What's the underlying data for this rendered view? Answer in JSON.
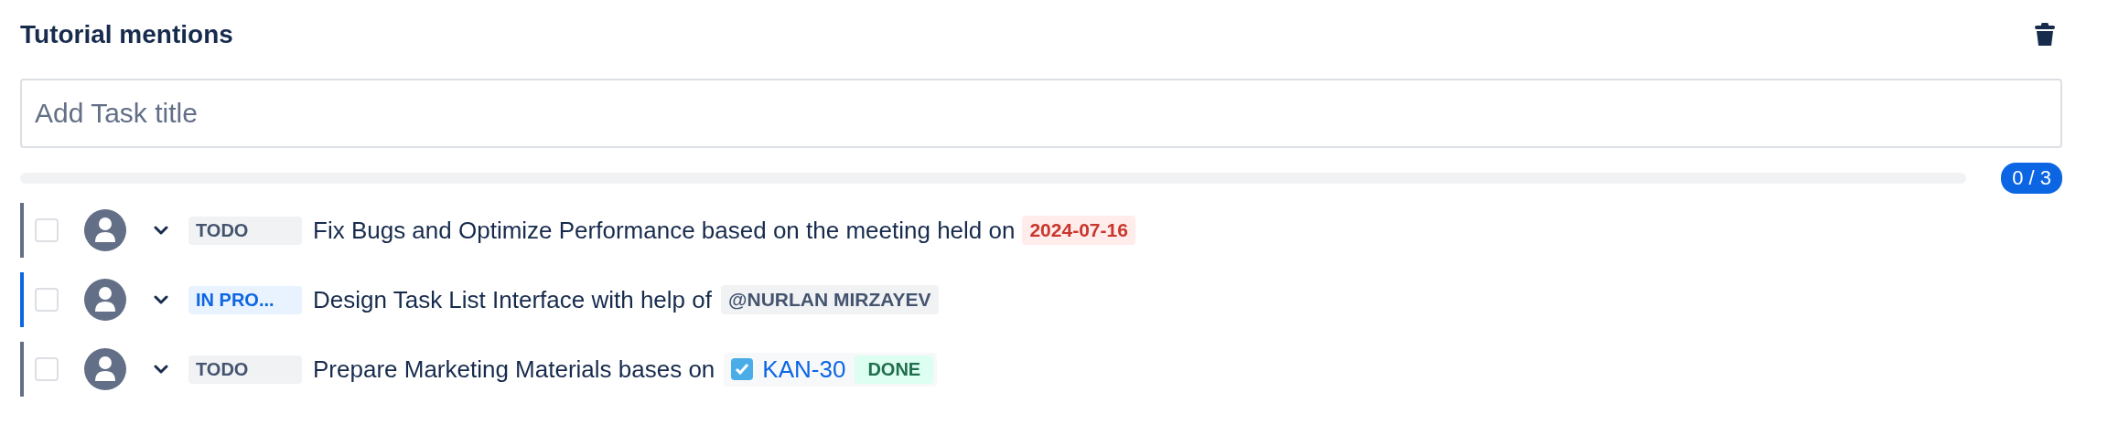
{
  "header": {
    "title": "Tutorial mentions"
  },
  "new_task": {
    "placeholder": "Add Task title"
  },
  "progress": {
    "level": 0,
    "count": "0 / 3"
  },
  "tasks": [
    {
      "checked": false,
      "expanded": false,
      "status": {
        "kind": "todo",
        "label": "TODO"
      },
      "parts": [
        {
          "kind": "text",
          "text": "Fix Bugs and Optimize Performance based on the meeting held on"
        },
        {
          "kind": "date",
          "text": "2024-07-16"
        }
      ]
    },
    {
      "checked": false,
      "expanded": false,
      "status": {
        "kind": "inprogress",
        "label": "IN PRO..."
      },
      "parts": [
        {
          "kind": "text",
          "text": "Design Task List Interface with help of"
        },
        {
          "kind": "mention",
          "text": "@NURLAN MIRZAYEV"
        }
      ]
    },
    {
      "checked": false,
      "expanded": false,
      "status": {
        "kind": "todo",
        "label": "TODO"
      },
      "parts": [
        {
          "kind": "text",
          "text": "Prepare Marketing Materials bases on"
        },
        {
          "kind": "issue",
          "key": "KAN-30",
          "status": "DONE"
        }
      ]
    }
  ]
}
